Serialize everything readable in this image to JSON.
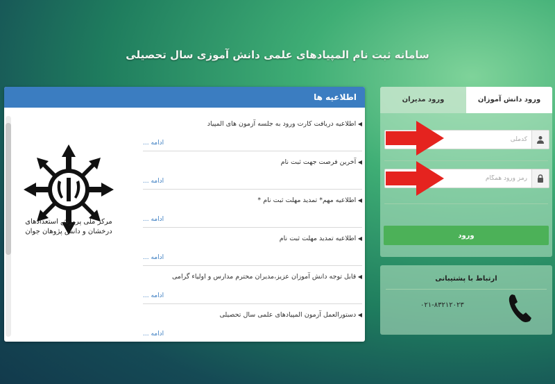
{
  "page": {
    "title": "سامانه ثبت نام المپیادهای علمی دانش آموزی سال تحصیلی"
  },
  "news": {
    "header": "اطلاعیه ها",
    "more_label": "ادامه",
    "items": [
      {
        "title": "اطلاعیه دریافت کارت ورود به جلسه آزمون های المپیاد"
      },
      {
        "title": "آخرین فرصت جهت ثبت نام"
      },
      {
        "title": "اطلاعیه مهم* تمدید مهلت ثبت نام *"
      },
      {
        "title": "اطلاعیه تمدید مهلت ثبت نام"
      },
      {
        "title": "قابل توجه دانش آموزان عزیز،مدیران محترم مدارس و اولیاء گرامی"
      },
      {
        "title": "دستورالعمل آزمون المپیادهای علمی سال تحصیلی"
      }
    ],
    "logo_text": "مرکز ملی پرورش استعدادهای درخشان و دانش پژوهان جوان"
  },
  "login": {
    "tab_student": "ورود دانش آموزان",
    "tab_manager": "ورود مدیران",
    "username_placeholder": "کدملی",
    "password_placeholder": "رمز ورود همگام",
    "submit_label": "ورود",
    "arrow_color": "#e5231f"
  },
  "support": {
    "title": "ارتباط با پشتیبانی",
    "phone": "۰۲۱-۸۳۲۱۲۰۲۳"
  },
  "colors": {
    "header_blue": "#3b7dc1",
    "button_green": "#4cb158"
  }
}
